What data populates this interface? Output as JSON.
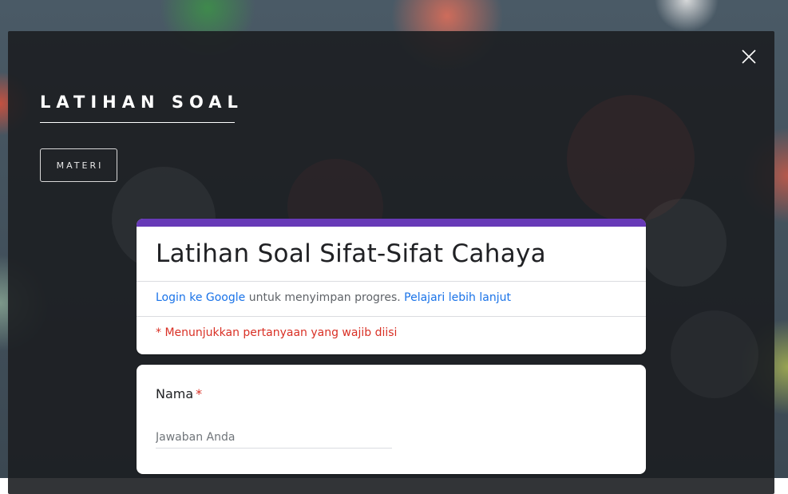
{
  "modal": {
    "title": "LATIHAN SOAL",
    "materi_button": "MATERI",
    "close_icon": "close-icon"
  },
  "form": {
    "accent_color": "#673ab7",
    "title": "Latihan Soal Sifat-Sifat Cahaya",
    "login_link": "Login ke Google",
    "login_text": " untuk menyimpan progres. ",
    "learn_more_link": "Pelajari lebih lanjut",
    "required_note": "* Menunjukkan pertanyaan yang wajib diisi",
    "questions": [
      {
        "label": "Nama",
        "required_marker": "*",
        "placeholder": "Jawaban Anda"
      }
    ]
  }
}
